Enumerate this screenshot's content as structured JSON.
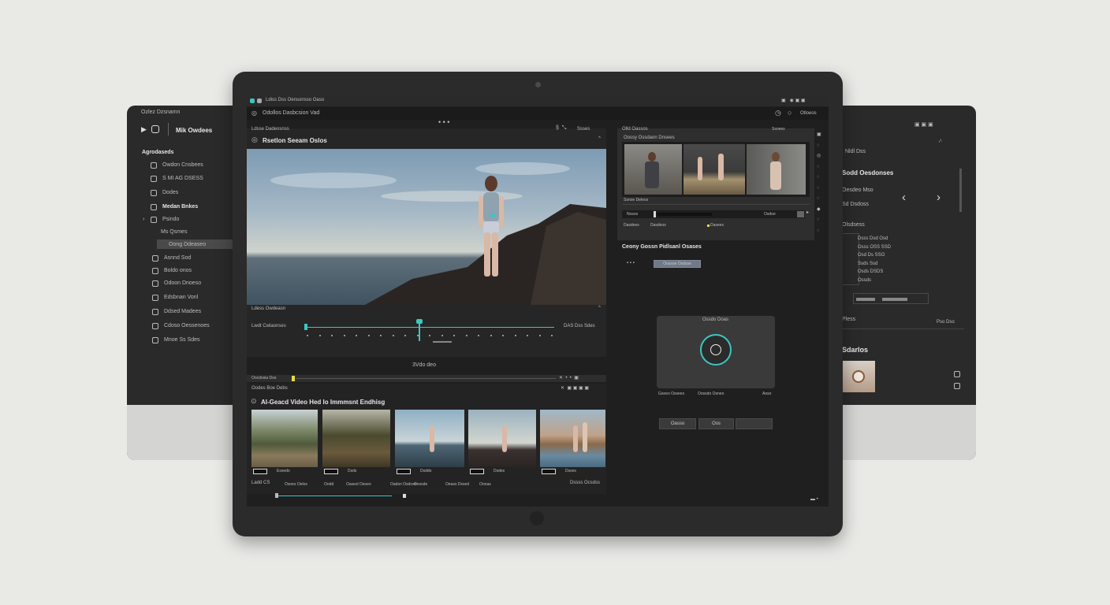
{
  "left_monitor": {
    "title": "Ozlez Dzsnamn",
    "app_name": "Mik Owdees",
    "section": "Agrodaseds",
    "items": [
      {
        "label": "Owdon Cnsbees"
      },
      {
        "label": "S MI AG DSESS"
      },
      {
        "label": "Dodes"
      },
      {
        "label": "Medan Bnkes"
      },
      {
        "label": "Psindo"
      },
      {
        "label": "Ms Qsmes"
      },
      {
        "label": "Oong Ddeaseo"
      },
      {
        "label": "Asnnd Sod"
      },
      {
        "label": "Boldo onos"
      },
      {
        "label": "Odoon Dnoeso"
      },
      {
        "label": "Edsbnan Vonl"
      },
      {
        "label": "Ddsed Madees"
      },
      {
        "label": "Cdoso Oessenoes"
      },
      {
        "label": "Mnoe Ss Sdes"
      }
    ]
  },
  "tablet": {
    "titlebar": "Ldiss Dss Oensonsso Oaso",
    "toolbar_title": "Odollos Dasbcsion Vad",
    "toolbar_right": "Otloeos",
    "preview": {
      "header": "Ldsse Dadeosnss",
      "header_right": "Ssses",
      "title": "Rsetlon Seeam Oslos",
      "below_label": "Ldess Owdeasn",
      "timeline_label": "Lwdt Cwlaonses",
      "timeline_value": "DAS Dss Sdes",
      "center_label": "3Vdo deo"
    },
    "clips": {
      "ruler_label": "Oocdosia Dos",
      "header_left": "Oodes Boe Debs",
      "title": "AI-Geacd Video Hed lo Immmsnt Endhisg",
      "items": [
        {
          "label": "Essedo"
        },
        {
          "label": "Dsds"
        },
        {
          "label": "Dsddo"
        },
        {
          "label": "Dsdes"
        },
        {
          "label": "Dsses"
        }
      ],
      "footer_left": "Ladd CS",
      "footer_right": "Dssss Ocsdss",
      "footer_tabs": [
        "Osnes Oelos",
        "Oodd",
        "Oasesl Osoeo",
        "Oadsn Osdoso",
        "Oessde",
        "Oeass Dssed",
        "Oonas"
      ]
    },
    "right": {
      "header": "Olld Oassos",
      "header_right": "Ssoees",
      "subheader": "Oossy Ossdaon Dnsees",
      "strip_label": "Ssnoe Deleos",
      "scrub_left": "Nosos",
      "scrub_value": "Osdoe",
      "bottom_row": [
        "Dasdees",
        "Dasdeos",
        "Dasees"
      ],
      "section_title": "Ceony Gossn Pidlsanl Osases",
      "chip_label": "Oossoe Osdsse",
      "dial_title": "Ossdo Doas",
      "dial_labels": [
        "Gsoeo Ossees",
        "Oossdo Osneo",
        "Aoso"
      ],
      "buttons": [
        "Oasso",
        "Oss",
        ""
      ]
    }
  },
  "right_monitor": {
    "top_label": "Nldl Dss",
    "title": "Sodd Oesdonses",
    "label2": "Oesdeo Mso",
    "label3": "Sd Dsdoss",
    "label4": "Olsdsess",
    "list": [
      "Dsss Dsd Osd",
      "Osss OSS SSD",
      "Osd Ds SSO",
      "Ssds Ssd",
      "Osds DSDS",
      "Ossds"
    ],
    "bottom_label": "Pless",
    "section_title": "Sdarlos",
    "slider_right": "Pso Dso"
  },
  "colors": {
    "accent": "#3cc6c0",
    "highlight": "#e8d84a",
    "bg": "#1f1f1f"
  }
}
